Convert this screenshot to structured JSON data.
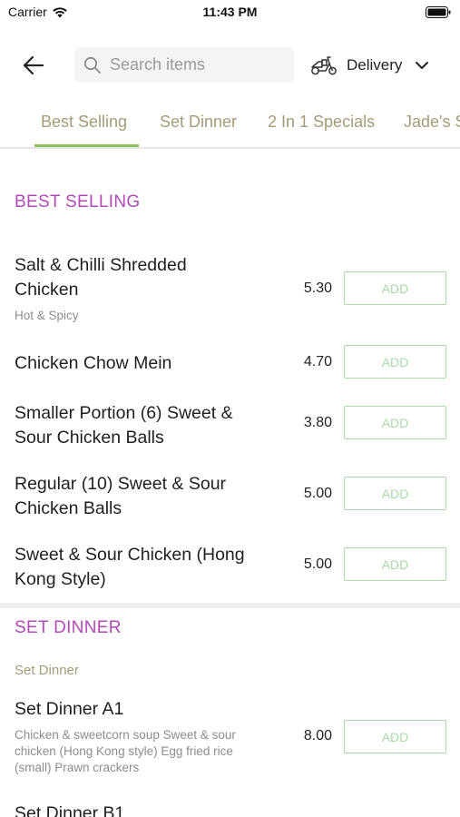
{
  "status": {
    "carrier": "Carrier",
    "time": "11:43 PM"
  },
  "header": {
    "search_placeholder": "Search items",
    "delivery_label": "Delivery"
  },
  "tabs": [
    "Best Selling",
    "Set Dinner",
    "2 In 1 Specials",
    "Jade's S"
  ],
  "colors": {
    "accent": "#b24ab8",
    "tab_text": "#a69b78",
    "tab_underline": "#8bbf5b",
    "add_button": "#a9dba8"
  },
  "sections": [
    {
      "title": "BEST SELLING",
      "items": [
        {
          "name_line1": "Salt & Chilli Shredded",
          "name_line2": "Chicken",
          "sub": "Hot & Spicy",
          "price": "5.30",
          "button": "ADD"
        },
        {
          "name_line1": "Chicken Chow Mein",
          "price": "4.70",
          "button": "ADD"
        },
        {
          "name_line1": "Smaller Portion (6) Sweet &",
          "name_line2": "Sour Chicken Balls",
          "price": "3.80",
          "button": "ADD"
        },
        {
          "name_line1": "Regular (10) Sweet & Sour",
          "name_line2": "Chicken Balls",
          "price": "5.00",
          "button": "ADD"
        },
        {
          "name_line1": "Sweet & Sour Chicken (Hong",
          "name_line2": "Kong Style)",
          "price": "5.00",
          "button": "ADD"
        }
      ]
    },
    {
      "title": "SET DINNER",
      "subheading": "Set Dinner",
      "items": [
        {
          "name_line1": "Set Dinner A1",
          "desc_lines": [
            "Chicken & sweetcorn soup  Sweet & sour",
            "chicken (Hong Kong style)  Egg fried rice",
            "(small)  Prawn crackers"
          ],
          "price": "8.00",
          "button": "ADD"
        },
        {
          "name_line1": "Set Dinner B1"
        }
      ]
    }
  ]
}
